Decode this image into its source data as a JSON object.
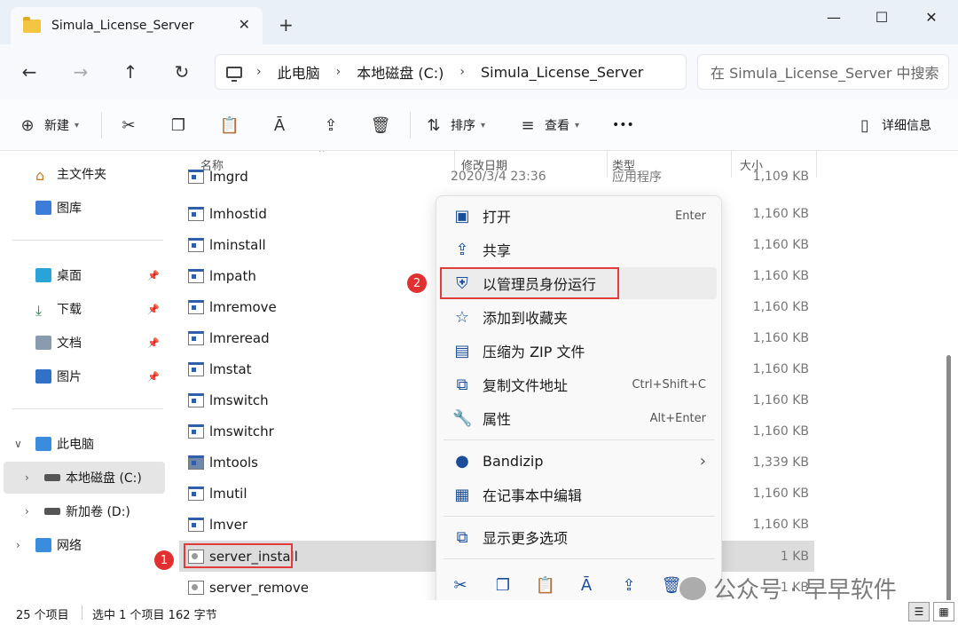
{
  "window": {
    "tab_title": "Simula_License_Server",
    "new_tab": "+",
    "minimize": "—",
    "maximize": "☐",
    "close": "✕"
  },
  "address": {
    "crumbs": [
      "此电脑",
      "本地磁盘 (C:)",
      "Simula_License_Server"
    ],
    "search_placeholder": "在 Simula_License_Server 中搜索"
  },
  "toolbar": {
    "new_label": "新建",
    "sort_label": "排序",
    "view_label": "查看",
    "more_label": "•••",
    "details_label": "详细信息"
  },
  "sidebar": {
    "items": [
      {
        "label": "主文件夹",
        "icon": "home-icon"
      },
      {
        "label": "图库",
        "icon": "gallery-icon"
      },
      {
        "label": "桌面",
        "icon": "desktop-icon"
      },
      {
        "label": "下载",
        "icon": "download-icon"
      },
      {
        "label": "文档",
        "icon": "document-icon"
      },
      {
        "label": "图片",
        "icon": "pictures-icon"
      },
      {
        "label": "此电脑",
        "icon": "pc-icon"
      },
      {
        "label": "本地磁盘 (C:)",
        "icon": "drive-icon"
      },
      {
        "label": "新加卷 (D:)",
        "icon": "drive-icon"
      },
      {
        "label": "网络",
        "icon": "network-icon"
      }
    ]
  },
  "columns": {
    "name": "名称",
    "date": "修改日期",
    "type": "类型",
    "size": "大小"
  },
  "files": [
    {
      "name": "lmgrd",
      "date": "2020/3/4 23:36",
      "type": "应用程序",
      "size": "1,109 KB"
    },
    {
      "name": "lmhostid",
      "size": "1,160 KB"
    },
    {
      "name": "lminstall",
      "size": "1,160 KB"
    },
    {
      "name": "lmpath",
      "size": "1,160 KB"
    },
    {
      "name": "lmremove",
      "size": "1,160 KB"
    },
    {
      "name": "lmreread",
      "size": "1,160 KB"
    },
    {
      "name": "lmstat",
      "size": "1,160 KB"
    },
    {
      "name": "lmswitch",
      "size": "1,160 KB"
    },
    {
      "name": "lmswitchr",
      "size": "1,160 KB"
    },
    {
      "name": "lmtools",
      "size": "1,339 KB"
    },
    {
      "name": "lmutil",
      "size": "1,160 KB"
    },
    {
      "name": "lmver",
      "size": "1,160 KB"
    },
    {
      "name": "server_install",
      "size": "1 KB"
    },
    {
      "name": "server_remove",
      "size": "1 KB"
    }
  ],
  "context_menu": {
    "items": [
      {
        "label": "打开",
        "shortcut": "Enter"
      },
      {
        "label": "共享",
        "shortcut": ""
      },
      {
        "label": "以管理员身份运行",
        "shortcut": ""
      },
      {
        "label": "添加到收藏夹",
        "shortcut": ""
      },
      {
        "label": "压缩为 ZIP 文件",
        "shortcut": ""
      },
      {
        "label": "复制文件地址",
        "shortcut": "Ctrl+Shift+C"
      },
      {
        "label": "属性",
        "shortcut": "Alt+Enter"
      },
      {
        "label": "Bandizip",
        "shortcut": ""
      },
      {
        "label": "在记事本中编辑",
        "shortcut": ""
      },
      {
        "label": "显示更多选项",
        "shortcut": ""
      }
    ],
    "submenu_arrow": "›"
  },
  "markers": {
    "one": "1",
    "two": "2"
  },
  "status": {
    "count": "25 个项目",
    "selection": "选中 1 个项目  162 字节"
  },
  "watermark": "公众号 · 早早软件",
  "colors": {
    "accent": "#1b4e9a",
    "marker": "#e03030",
    "selection": "#dcdcdc"
  }
}
